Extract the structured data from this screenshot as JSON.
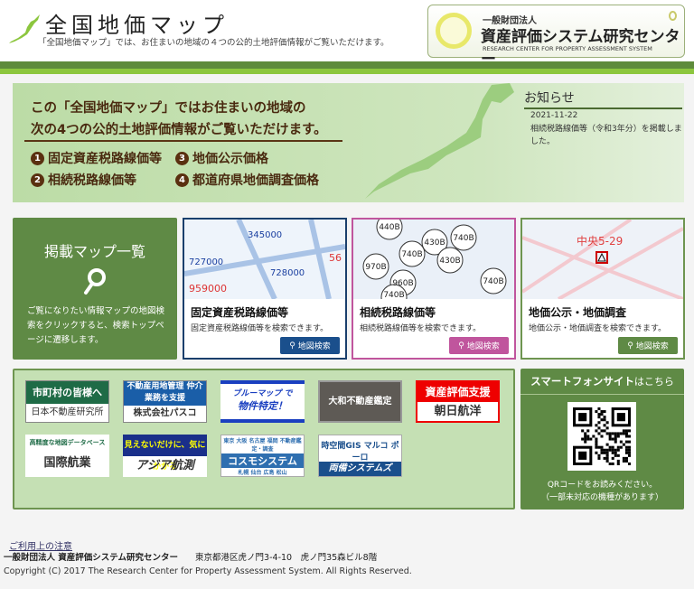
{
  "header": {
    "title": "全国地価マップ",
    "subtitle": "「全国地価マップ」では、お住まいの地域の４つの公的土地評価情報がご覧いただけます。",
    "org_logo": {
      "line1": "一般財団法人",
      "line2": "資産評価システム研究センター",
      "line3": "RESEARCH CENTER FOR PROPERTY ASSESSMENT SYSTEM"
    }
  },
  "banner": {
    "line1": "この「全国地価マップ」ではお住まいの地域の",
    "line2": "次の4つの公的土地評価情報がご覧いただけます。",
    "items": [
      {
        "num": "1",
        "label": "固定資産税路線価等"
      },
      {
        "num": "2",
        "label": "相続税路線価等"
      },
      {
        "num": "3",
        "label": "地価公示価格"
      },
      {
        "num": "4",
        "label": "都道府県地価調査価格"
      }
    ]
  },
  "news": {
    "title": "お知らせ",
    "date": "2021-11-22",
    "text": "相続税路線価等（令和3年分）を掲載しました。"
  },
  "maplist": {
    "title": "掲載マップ一覧",
    "description": "ご覧になりたい情報マップの地図検索をクリックすると、検索トップページに遷移します。"
  },
  "cards": [
    {
      "title": "固定資産税路線価等",
      "desc": "固定資産税路線価等を検索できます。",
      "button": "地図検索",
      "color": "#1a4f8c"
    },
    {
      "title": "相続税路線価等",
      "desc": "相続税路線価等を検索できます。",
      "button": "地図検索",
      "color": "#c0559d"
    },
    {
      "title": "地価公示・地価調査",
      "desc": "地価公示・地価調査を検索できます。",
      "button": "地図検索",
      "color": "#5f8a45"
    }
  ],
  "map_labels": {
    "card1": [
      "345000",
      "727000",
      "728000",
      "959000",
      "56"
    ],
    "card2": [
      "440B",
      "430B",
      "740B",
      "970B",
      "740B",
      "960B",
      "430B",
      "740B",
      "740B"
    ],
    "card3": "中央5-29"
  },
  "ads": [
    {
      "top": "市町村の皆様へ",
      "bottom": "日本不動産研究所"
    },
    {
      "top": "不動産用地管理 仲介業務を支援",
      "bottom": "株式会社パスコ"
    },
    {
      "top": "ブルーマップ で",
      "bottom": "物件特定！"
    },
    {
      "top": "大和不動産鑑定",
      "bottom": ""
    },
    {
      "top": "資産評価支援",
      "bottom": "朝日航洋"
    },
    {
      "top": "高精度な地図データベース",
      "bottom": "国際航業"
    },
    {
      "top": "見えないだけに、気にかかる",
      "bottom": "アジア航測"
    },
    {
      "top": "東京 大阪 名古屋 福岡 不動産鑑定・調査",
      "bottom": "コスモシステム",
      "extra": "札幌 仙台 広島 松山"
    },
    {
      "top": "時空間GIS マルコ ポーロ",
      "bottom": "両備システムズ"
    }
  ],
  "smartphone": {
    "title_bold": "スマートフォンサイト",
    "title_rest": "はこちら",
    "note1": "QRコードをお読みください。",
    "note2": "（一部未対応の機種があります）"
  },
  "footer": {
    "link": "ご利用上の注意",
    "org": "一般財団法人 資産評価システム研究センター",
    "address": "東京都港区虎ノ門3-4-10　虎ノ門35森ビル8階",
    "copyright": "Copyright (C) 2017 The Research Center for Property Assessment System. All Rights Reserved."
  }
}
